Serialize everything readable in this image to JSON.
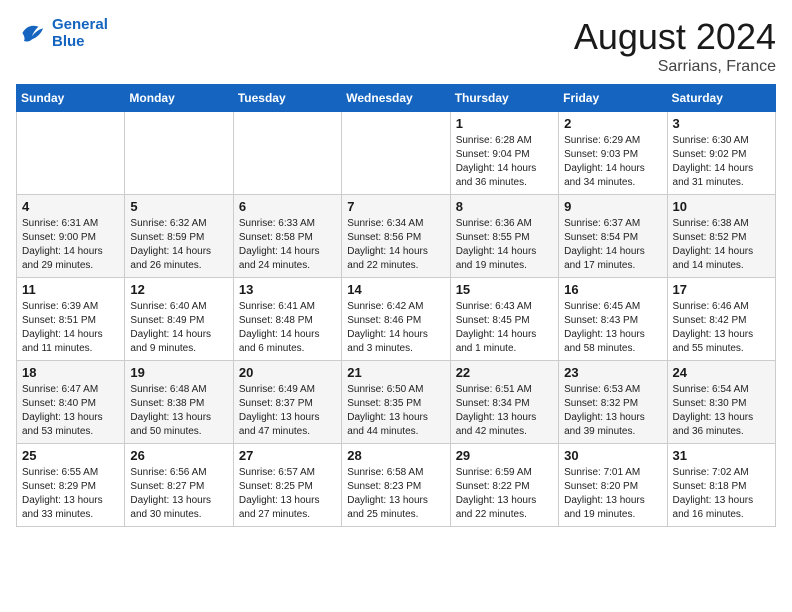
{
  "logo": {
    "line1": "General",
    "line2": "Blue"
  },
  "title": "August 2024",
  "location": "Sarrians, France",
  "weekdays": [
    "Sunday",
    "Monday",
    "Tuesday",
    "Wednesday",
    "Thursday",
    "Friday",
    "Saturday"
  ],
  "weeks": [
    [
      {
        "day": "",
        "info": ""
      },
      {
        "day": "",
        "info": ""
      },
      {
        "day": "",
        "info": ""
      },
      {
        "day": "",
        "info": ""
      },
      {
        "day": "1",
        "info": "Sunrise: 6:28 AM\nSunset: 9:04 PM\nDaylight: 14 hours\nand 36 minutes."
      },
      {
        "day": "2",
        "info": "Sunrise: 6:29 AM\nSunset: 9:03 PM\nDaylight: 14 hours\nand 34 minutes."
      },
      {
        "day": "3",
        "info": "Sunrise: 6:30 AM\nSunset: 9:02 PM\nDaylight: 14 hours\nand 31 minutes."
      }
    ],
    [
      {
        "day": "4",
        "info": "Sunrise: 6:31 AM\nSunset: 9:00 PM\nDaylight: 14 hours\nand 29 minutes."
      },
      {
        "day": "5",
        "info": "Sunrise: 6:32 AM\nSunset: 8:59 PM\nDaylight: 14 hours\nand 26 minutes."
      },
      {
        "day": "6",
        "info": "Sunrise: 6:33 AM\nSunset: 8:58 PM\nDaylight: 14 hours\nand 24 minutes."
      },
      {
        "day": "7",
        "info": "Sunrise: 6:34 AM\nSunset: 8:56 PM\nDaylight: 14 hours\nand 22 minutes."
      },
      {
        "day": "8",
        "info": "Sunrise: 6:36 AM\nSunset: 8:55 PM\nDaylight: 14 hours\nand 19 minutes."
      },
      {
        "day": "9",
        "info": "Sunrise: 6:37 AM\nSunset: 8:54 PM\nDaylight: 14 hours\nand 17 minutes."
      },
      {
        "day": "10",
        "info": "Sunrise: 6:38 AM\nSunset: 8:52 PM\nDaylight: 14 hours\nand 14 minutes."
      }
    ],
    [
      {
        "day": "11",
        "info": "Sunrise: 6:39 AM\nSunset: 8:51 PM\nDaylight: 14 hours\nand 11 minutes."
      },
      {
        "day": "12",
        "info": "Sunrise: 6:40 AM\nSunset: 8:49 PM\nDaylight: 14 hours\nand 9 minutes."
      },
      {
        "day": "13",
        "info": "Sunrise: 6:41 AM\nSunset: 8:48 PM\nDaylight: 14 hours\nand 6 minutes."
      },
      {
        "day": "14",
        "info": "Sunrise: 6:42 AM\nSunset: 8:46 PM\nDaylight: 14 hours\nand 3 minutes."
      },
      {
        "day": "15",
        "info": "Sunrise: 6:43 AM\nSunset: 8:45 PM\nDaylight: 14 hours\nand 1 minute."
      },
      {
        "day": "16",
        "info": "Sunrise: 6:45 AM\nSunset: 8:43 PM\nDaylight: 13 hours\nand 58 minutes."
      },
      {
        "day": "17",
        "info": "Sunrise: 6:46 AM\nSunset: 8:42 PM\nDaylight: 13 hours\nand 55 minutes."
      }
    ],
    [
      {
        "day": "18",
        "info": "Sunrise: 6:47 AM\nSunset: 8:40 PM\nDaylight: 13 hours\nand 53 minutes."
      },
      {
        "day": "19",
        "info": "Sunrise: 6:48 AM\nSunset: 8:38 PM\nDaylight: 13 hours\nand 50 minutes."
      },
      {
        "day": "20",
        "info": "Sunrise: 6:49 AM\nSunset: 8:37 PM\nDaylight: 13 hours\nand 47 minutes."
      },
      {
        "day": "21",
        "info": "Sunrise: 6:50 AM\nSunset: 8:35 PM\nDaylight: 13 hours\nand 44 minutes."
      },
      {
        "day": "22",
        "info": "Sunrise: 6:51 AM\nSunset: 8:34 PM\nDaylight: 13 hours\nand 42 minutes."
      },
      {
        "day": "23",
        "info": "Sunrise: 6:53 AM\nSunset: 8:32 PM\nDaylight: 13 hours\nand 39 minutes."
      },
      {
        "day": "24",
        "info": "Sunrise: 6:54 AM\nSunset: 8:30 PM\nDaylight: 13 hours\nand 36 minutes."
      }
    ],
    [
      {
        "day": "25",
        "info": "Sunrise: 6:55 AM\nSunset: 8:29 PM\nDaylight: 13 hours\nand 33 minutes."
      },
      {
        "day": "26",
        "info": "Sunrise: 6:56 AM\nSunset: 8:27 PM\nDaylight: 13 hours\nand 30 minutes."
      },
      {
        "day": "27",
        "info": "Sunrise: 6:57 AM\nSunset: 8:25 PM\nDaylight: 13 hours\nand 27 minutes."
      },
      {
        "day": "28",
        "info": "Sunrise: 6:58 AM\nSunset: 8:23 PM\nDaylight: 13 hours\nand 25 minutes."
      },
      {
        "day": "29",
        "info": "Sunrise: 6:59 AM\nSunset: 8:22 PM\nDaylight: 13 hours\nand 22 minutes."
      },
      {
        "day": "30",
        "info": "Sunrise: 7:01 AM\nSunset: 8:20 PM\nDaylight: 13 hours\nand 19 minutes."
      },
      {
        "day": "31",
        "info": "Sunrise: 7:02 AM\nSunset: 8:18 PM\nDaylight: 13 hours\nand 16 minutes."
      }
    ]
  ]
}
